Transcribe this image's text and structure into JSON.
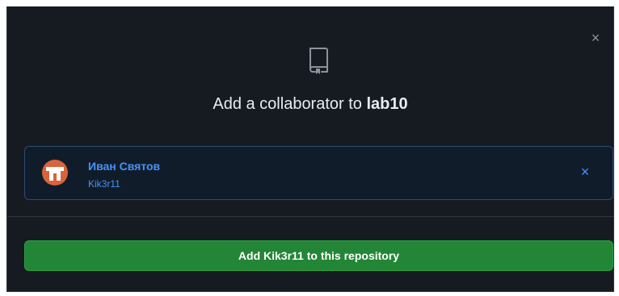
{
  "dialog": {
    "title_prefix": "Add a collaborator to",
    "repo_name": "lab10",
    "close_icon": "close-icon",
    "repo_icon": "repo-icon"
  },
  "selected_user": {
    "display_name": "Иван Святов",
    "login": "Kik3r11",
    "remove_icon": "remove-icon",
    "avatar_color": "#d9643b"
  },
  "add_button": {
    "label": "Add Kik3r11 to this repository"
  },
  "colors": {
    "background": "#161b22",
    "border": "#30363d",
    "accent_blue": "#4493f8",
    "button_green": "#238636",
    "text": "#e6edf3"
  }
}
